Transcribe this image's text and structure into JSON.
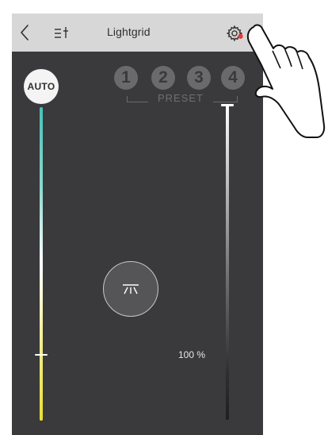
{
  "app": {
    "title": "Lightgrid"
  },
  "header": {
    "back_icon": "chevron-left-icon",
    "filter_icon": "sliders-icon",
    "settings_icon": "gear-icon",
    "settings_badge_color": "#e53935"
  },
  "controls": {
    "auto_label": "AUTO",
    "presets": {
      "label": "PRESET",
      "items": [
        {
          "label": "1"
        },
        {
          "label": "2"
        },
        {
          "label": "3"
        },
        {
          "label": "4"
        }
      ]
    },
    "color_temperature": {
      "level": 0.79,
      "colors": {
        "top": "#48c1b7",
        "middle": "#ffffff",
        "bottom": "#ecde31"
      }
    },
    "brightness": {
      "level": 1.0,
      "value_text": "100 %",
      "colors": {
        "top": "#ffffff",
        "bottom": "#1f1f1f"
      }
    },
    "center_light_icon": "ceiling-light-icon"
  },
  "overlay": {
    "hand_icon": "hand-pointer-icon"
  }
}
